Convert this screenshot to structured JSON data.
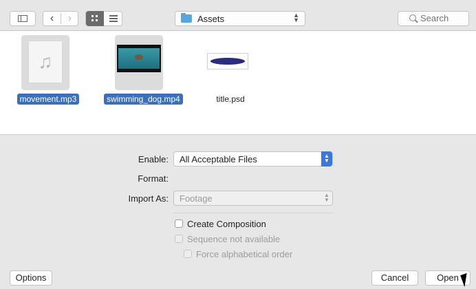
{
  "toolbar": {
    "sidebar_icon": "sidebar-icon",
    "back_label": "‹",
    "forward_label": "›",
    "icon_view_icon": "grid-icon",
    "list_view_icon": "list-icon",
    "location": "Assets",
    "search_placeholder": "Search"
  },
  "files": [
    {
      "name": "movement.mp3",
      "selected": true,
      "icon": "music-note-icon"
    },
    {
      "name": "swimming_dog.mp4",
      "selected": true,
      "icon": "video-thumbnail"
    },
    {
      "name": "title.psd",
      "selected": false,
      "icon": "psd-thumbnail"
    }
  ],
  "options": {
    "enable_label": "Enable:",
    "enable_value": "All Acceptable Files",
    "format_label": "Format:",
    "import_as_label": "Import As:",
    "import_as_value": "Footage",
    "create_composition": "Create Composition",
    "sequence": "Sequence not available",
    "force_alphabetical": "Force alphabetical order"
  },
  "buttons": {
    "options": "Options",
    "cancel": "Cancel",
    "open": "Open"
  },
  "colors": {
    "selection": "#3d6fb6",
    "accent": "#3b78d8",
    "folder": "#5aa6dc"
  }
}
